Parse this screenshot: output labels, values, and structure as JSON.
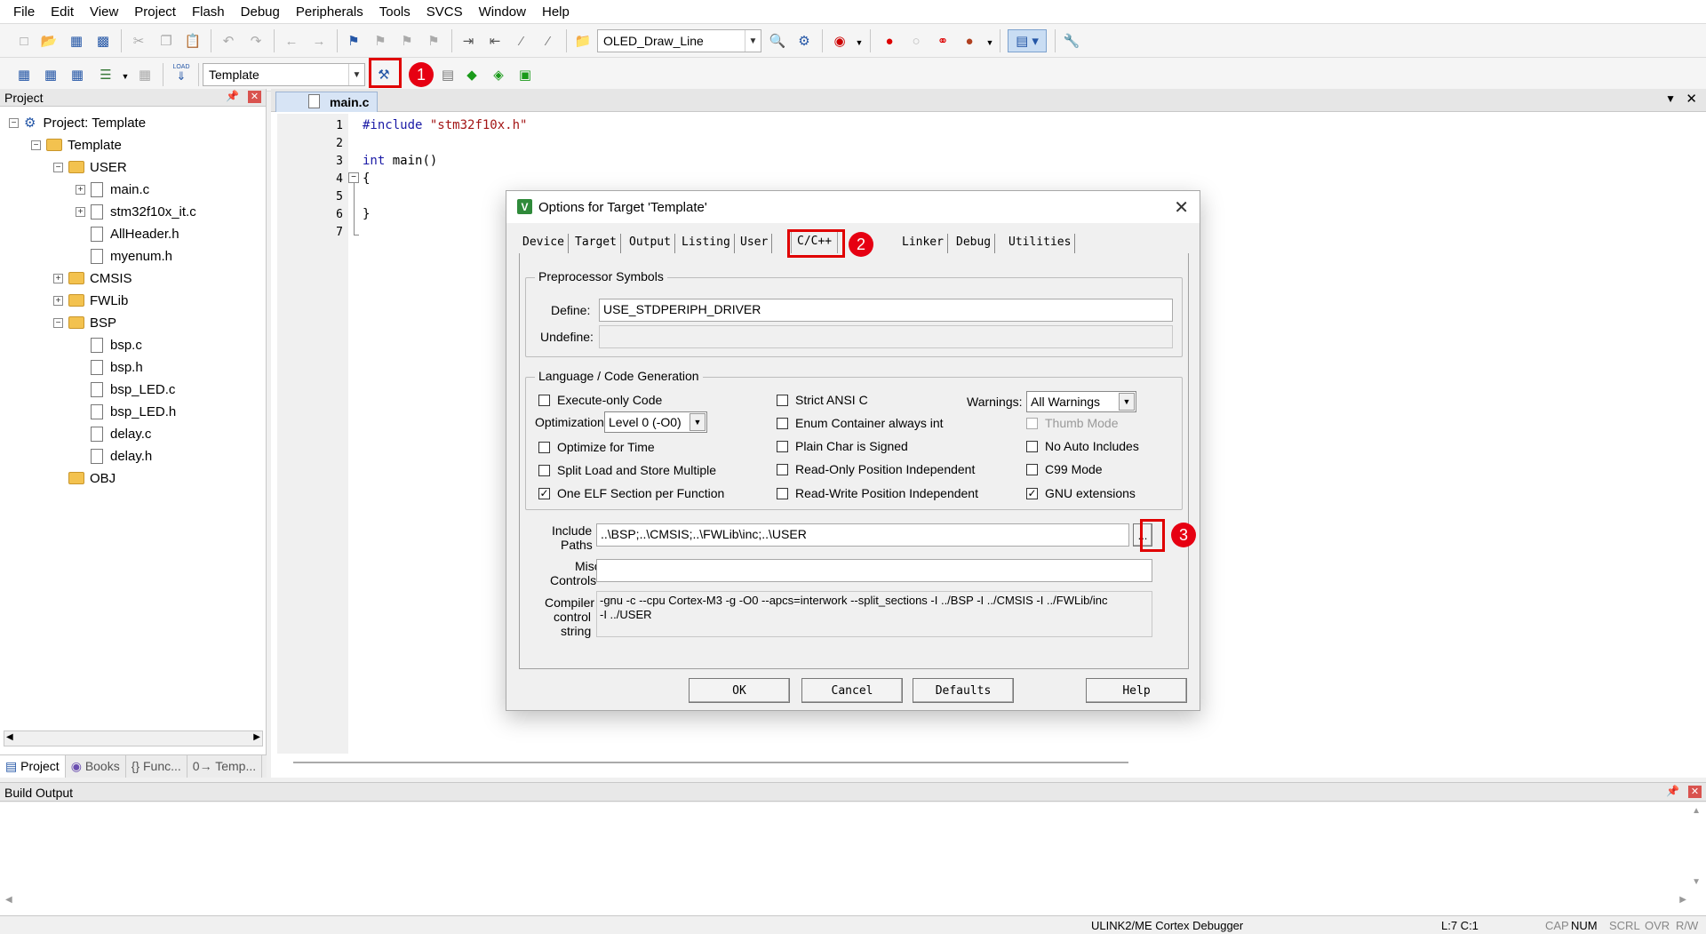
{
  "menu": [
    "File",
    "Edit",
    "View",
    "Project",
    "Flash",
    "Debug",
    "Peripherals",
    "Tools",
    "SVCS",
    "Window",
    "Help"
  ],
  "toolbar1": {
    "target_combo": "OLED_Draw_Line"
  },
  "toolbar2": {
    "target_select": "Template",
    "load_label": "LOAD"
  },
  "annotations": {
    "one": "1",
    "two": "2",
    "three": "3"
  },
  "project": {
    "title": "Project",
    "root": "Project: Template",
    "target": "Template",
    "groups": {
      "user": "USER",
      "cmsis": "CMSIS",
      "fwlib": "FWLib",
      "bsp": "BSP",
      "obj": "OBJ"
    },
    "user_files": [
      "main.c",
      "stm32f10x_it.c",
      "AllHeader.h",
      "myenum.h"
    ],
    "bsp_files": [
      "bsp.c",
      "bsp.h",
      "bsp_LED.c",
      "bsp_LED.h",
      "delay.c",
      "delay.h"
    ],
    "tabs": [
      "Project",
      "Books",
      "{} Func...",
      "0→ Temp..."
    ]
  },
  "editor": {
    "tab": "main.c",
    "lines": [
      "1",
      "2",
      "3",
      "4",
      "5",
      "6",
      "7"
    ],
    "code": {
      "include_kw": "#include",
      "include_str": "\"stm32f10x.h\"",
      "int_kw": "int",
      "main_fn": " main()",
      "open": "{",
      "close": "}"
    }
  },
  "dialog": {
    "title": "Options for Target 'Template'",
    "tabs": [
      "Device",
      "Target",
      "Output",
      "Listing",
      "User",
      "C/C++",
      "Linker",
      "Debug",
      "Utilities"
    ],
    "preprocessor": {
      "group": "Preprocessor Symbols",
      "define_label": "Define:",
      "define_value": "USE_STDPERIPH_DRIVER",
      "undefine_label": "Undefine:",
      "undefine_value": ""
    },
    "language": {
      "group": "Language / Code Generation",
      "execute_only": "Execute-only Code",
      "optimization_label": "Optimization:",
      "optimization_value": "Level 0 (-O0)",
      "optimize_time": "Optimize for Time",
      "split_load": "Split Load and Store Multiple",
      "one_elf": "One ELF Section per Function",
      "strict_ansi": "Strict ANSI C",
      "enum_container": "Enum Container always int",
      "plain_char": "Plain Char is Signed",
      "ro_pos": "Read-Only Position Independent",
      "rw_pos": "Read-Write Position Independent",
      "warnings_label": "Warnings:",
      "warnings_value": "All Warnings",
      "thumb_mode": "Thumb Mode",
      "no_auto": "No Auto Includes",
      "c99": "C99 Mode",
      "gnu_ext": "GNU extensions",
      "checked": {
        "one_elf": true,
        "gnu_ext": true
      }
    },
    "include_label_1": "Include",
    "include_label_2": "Paths",
    "include_value": "..\\BSP;..\\CMSIS;..\\FWLib\\inc;..\\USER",
    "browse": "...",
    "misc_label_1": "Misc",
    "misc_label_2": "Controls",
    "misc_value": "",
    "compiler_label_1": "Compiler",
    "compiler_label_2": "control",
    "compiler_label_3": "string",
    "compiler_line1": "-gnu -c --cpu Cortex-M3 -g -O0 --apcs=interwork --split_sections -I ../BSP -I ../CMSIS -I ../FWLib/inc",
    "compiler_line2": "-I ../USER",
    "buttons": {
      "ok": "OK",
      "cancel": "Cancel",
      "defaults": "Defaults",
      "help": "Help"
    }
  },
  "build_output": {
    "title": "Build Output"
  },
  "status": {
    "debugger": "ULINK2/ME Cortex Debugger",
    "position": "L:7 C:1",
    "cap": "CAP",
    "num": "NUM",
    "scrl": "SCRL",
    "ovr": "OVR",
    "rw": "R/W"
  }
}
